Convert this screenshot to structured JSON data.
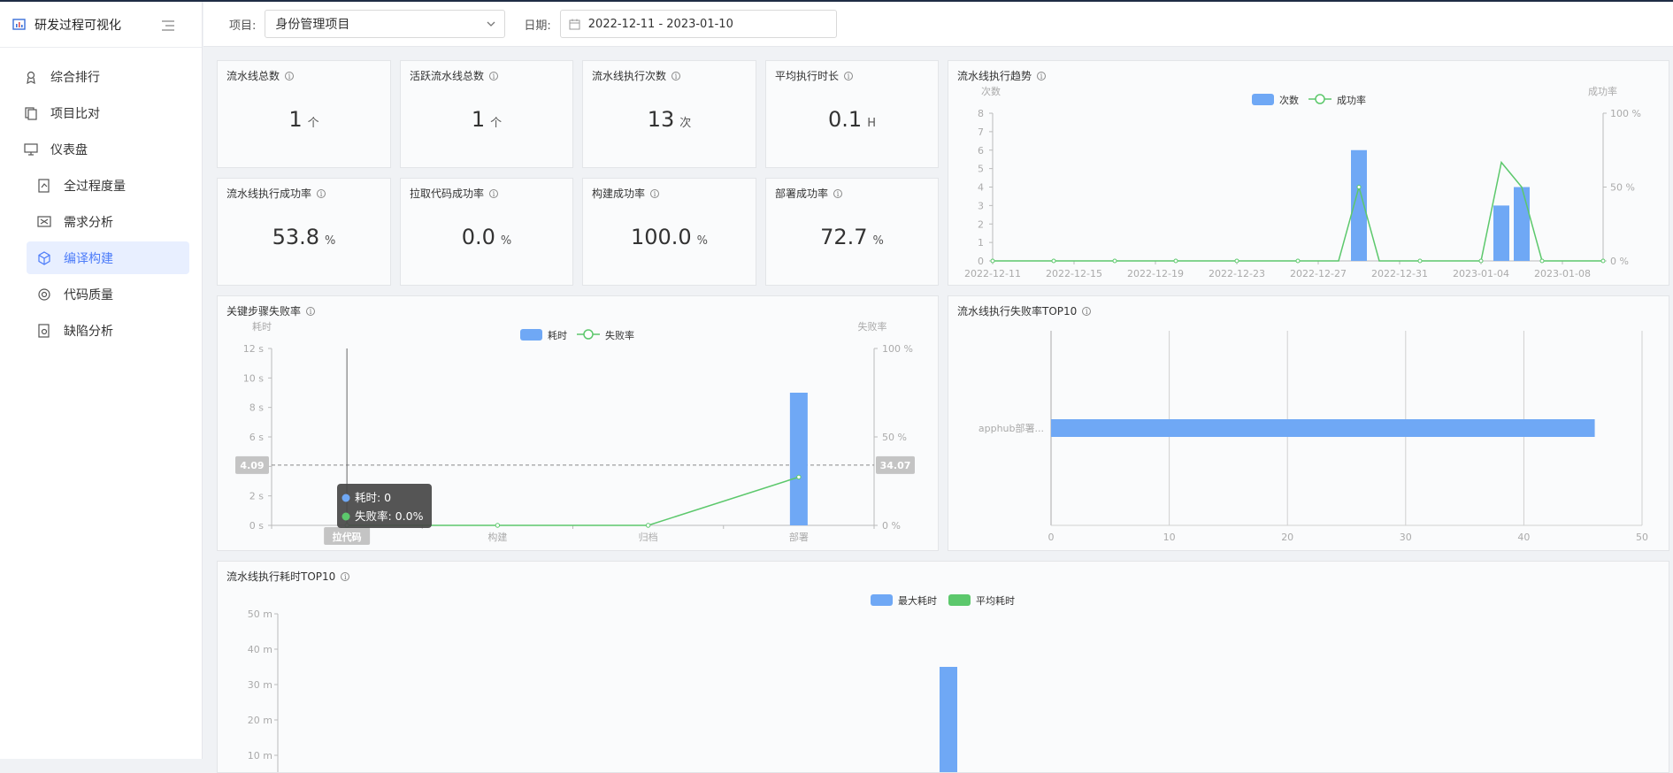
{
  "app": {
    "title": "研发过程可视化"
  },
  "sidebar": {
    "items": [
      {
        "label": "综合排行",
        "icon": "ranking-icon"
      },
      {
        "label": "项目比对",
        "icon": "compare-icon"
      },
      {
        "label": "仪表盘",
        "icon": "dashboard-icon"
      },
      {
        "label": "全过程度量",
        "icon": "measure-icon"
      },
      {
        "label": "需求分析",
        "icon": "requirement-icon"
      },
      {
        "label": "编译构建",
        "icon": "cube-icon"
      },
      {
        "label": "代码质量",
        "icon": "code-quality-icon"
      },
      {
        "label": "缺陷分析",
        "icon": "defect-icon"
      }
    ]
  },
  "filters": {
    "project_label": "项目:",
    "project_value": "身份管理项目",
    "date_label": "日期:",
    "date_value": "2022-12-11 - 2023-01-10"
  },
  "stats": [
    {
      "title": "流水线总数",
      "value": "1",
      "unit": "个"
    },
    {
      "title": "活跃流水线总数",
      "value": "1",
      "unit": "个"
    },
    {
      "title": "流水线执行次数",
      "value": "13",
      "unit": "次"
    },
    {
      "title": "平均执行时长",
      "value": "0.1",
      "unit": "H"
    },
    {
      "title": "流水线执行成功率",
      "value": "53.8",
      "unit": "%"
    },
    {
      "title": "拉取代码成功率",
      "value": "0.0",
      "unit": "%"
    },
    {
      "title": "构建成功率",
      "value": "100.0",
      "unit": "%"
    },
    {
      "title": "部署成功率",
      "value": "72.7",
      "unit": "%"
    }
  ],
  "chart_data": [
    {
      "id": "trend",
      "type": "bar",
      "title": "流水线执行趋势",
      "legend": [
        "次数",
        "成功率"
      ],
      "y_left_label": "次数",
      "y_right_label": "成功率",
      "ylim_left": [
        0,
        8
      ],
      "ylim_right": [
        0,
        100
      ],
      "y_left_ticks": [
        "0",
        "1",
        "2",
        "3",
        "4",
        "5",
        "6",
        "7",
        "8"
      ],
      "y_right_ticks": [
        "0 %",
        "50 %",
        "100 %"
      ],
      "x_tick_labels": [
        "2022-12-11",
        "2022-12-15",
        "2022-12-19",
        "2022-12-23",
        "2022-12-27",
        "2022-12-31",
        "2023-01-04",
        "2023-01-08"
      ],
      "x": [
        "2022-12-11",
        "2022-12-12",
        "2022-12-13",
        "2022-12-14",
        "2022-12-15",
        "2022-12-16",
        "2022-12-17",
        "2022-12-18",
        "2022-12-19",
        "2022-12-20",
        "2022-12-21",
        "2022-12-22",
        "2022-12-23",
        "2022-12-24",
        "2022-12-25",
        "2022-12-26",
        "2022-12-27",
        "2022-12-28",
        "2022-12-29",
        "2022-12-30",
        "2022-12-31",
        "2023-01-01",
        "2023-01-02",
        "2023-01-03",
        "2023-01-04",
        "2023-01-05",
        "2023-01-06",
        "2023-01-07",
        "2023-01-08",
        "2023-01-09",
        "2023-01-10"
      ],
      "series": [
        {
          "name": "次数",
          "kind": "bar",
          "color": "#6fa8f5",
          "values": [
            0,
            0,
            0,
            0,
            0,
            0,
            0,
            0,
            0,
            0,
            0,
            0,
            0,
            0,
            0,
            0,
            0,
            0,
            6,
            0,
            0,
            0,
            0,
            0,
            0,
            3,
            4,
            0,
            0,
            0,
            0
          ]
        },
        {
          "name": "成功率",
          "kind": "line",
          "color": "#5cc86c",
          "values": [
            0,
            0,
            0,
            0,
            0,
            0,
            0,
            0,
            0,
            0,
            0,
            0,
            0,
            0,
            0,
            0,
            0,
            0,
            50,
            0,
            0,
            0,
            0,
            0,
            0,
            66.7,
            50,
            0,
            0,
            0,
            0
          ]
        }
      ]
    },
    {
      "id": "step_fail",
      "type": "bar",
      "title": "关键步骤失败率",
      "legend": [
        "耗时",
        "失败率"
      ],
      "y_left_label": "耗时",
      "y_right_label": "失败率",
      "ylim_left": [
        0,
        12
      ],
      "ylim_right": [
        0,
        100
      ],
      "y_left_ticks": [
        "0 s",
        "2 s",
        "4 s",
        "6 s",
        "8 s",
        "10 s",
        "12 s"
      ],
      "y_right_ticks": [
        "0 %",
        "50 %",
        "100 %"
      ],
      "categories": [
        "拉代码",
        "构建",
        "归档",
        "部署"
      ],
      "series": [
        {
          "name": "耗时",
          "kind": "bar",
          "color": "#6fa8f5",
          "values": [
            0,
            0,
            0,
            9
          ]
        },
        {
          "name": "失败率",
          "kind": "line",
          "color": "#5cc86c",
          "values": [
            0,
            0,
            0,
            27.3
          ]
        }
      ],
      "crosshair": {
        "left_value": "4.09",
        "right_value": "34.07",
        "category": "拉代码"
      },
      "tooltip": {
        "line1": "耗时: 0",
        "line2": "失败率: 0.0%"
      }
    },
    {
      "id": "fail_top10",
      "type": "bar",
      "orientation": "horizontal",
      "title": "流水线执行失败率TOP10",
      "categories": [
        "apphub部署..."
      ],
      "values": [
        46
      ],
      "xlim": [
        0,
        50
      ],
      "x_ticks": [
        "0",
        "10",
        "20",
        "30",
        "40",
        "50"
      ],
      "color": "#6fa8f5"
    },
    {
      "id": "duration_top10",
      "type": "bar",
      "title": "流水线执行耗时TOP10",
      "legend": [
        "最大耗时",
        "平均耗时"
      ],
      "legend_colors": [
        "#6fa8f5",
        "#5cc86c"
      ],
      "ylim": [
        0,
        50
      ],
      "y_ticks": [
        "10 m",
        "20 m",
        "30 m",
        "40 m",
        "50 m"
      ],
      "series": [
        {
          "name": "最大耗时",
          "values": [
            35
          ]
        }
      ]
    }
  ]
}
